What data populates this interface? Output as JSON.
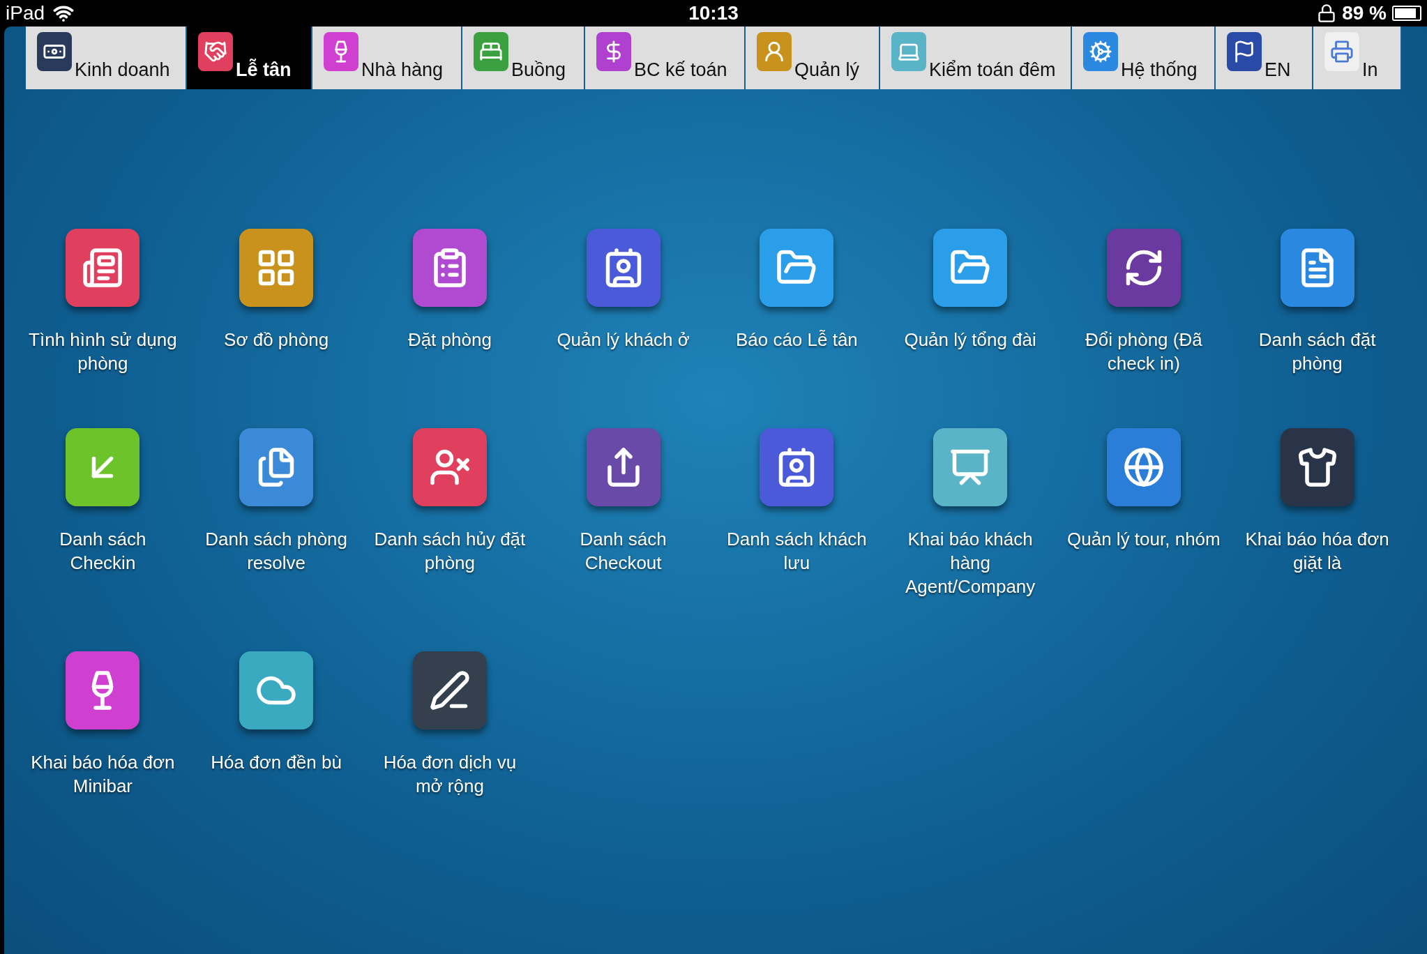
{
  "status_bar": {
    "device": "iPad",
    "time": "10:13",
    "battery": "89 %"
  },
  "tabs": [
    {
      "label": "Kinh doanh",
      "selected": false
    },
    {
      "label": "Lễ tân",
      "selected": true
    },
    {
      "label": "Nhà hàng",
      "selected": false
    },
    {
      "label": "Buồng",
      "selected": false
    },
    {
      "label": "BC kế toán",
      "selected": false
    },
    {
      "label": "Quản lý",
      "selected": false
    },
    {
      "label": "Kiểm toán đêm",
      "selected": false
    },
    {
      "label": "Hệ thống",
      "selected": false
    },
    {
      "label": "EN",
      "selected": false
    },
    {
      "label": "In",
      "selected": false
    }
  ],
  "apps": [
    {
      "label": "Tình hình sử dụng phòng",
      "color": "#e0405e"
    },
    {
      "label": "Sơ đồ phòng",
      "color": "#c8921c"
    },
    {
      "label": "Đặt phòng",
      "color": "#b04ad0"
    },
    {
      "label": "Quản lý khách ở",
      "color": "#4a5ad8"
    },
    {
      "label": "Báo cáo Lễ tân",
      "color": "#2a9ee8"
    },
    {
      "label": "Quản lý tổng đài",
      "color": "#2a9ee8"
    },
    {
      "label": "Đổi phòng (Đã check in)",
      "color": "#6a3aa0"
    },
    {
      "label": "Danh sách đặt phòng",
      "color": "#2a88e0"
    },
    {
      "label": "Danh sách Checkin",
      "color": "#6cc42a"
    },
    {
      "label": "Danh sách phòng resolve",
      "color": "#3a8ad8"
    },
    {
      "label": "Danh sách hủy đặt phòng",
      "color": "#e0405e"
    },
    {
      "label": "Danh sách Checkout",
      "color": "#6a4aa8"
    },
    {
      "label": "Danh sách khách lưu",
      "color": "#4a5ad8"
    },
    {
      "label": "Khai báo khách hàng Agent/Company",
      "color": "#5ab4c8"
    },
    {
      "label": "Quản lý tour, nhóm",
      "color": "#2a7ed8"
    },
    {
      "label": "Khai báo hóa đơn giặt là",
      "color": "#2a3448"
    },
    {
      "label": "Khai báo hóa đơn Minibar",
      "color": "#d040d0"
    },
    {
      "label": "Hóa đơn đền bù",
      "color": "#3aaac0"
    },
    {
      "label": "Hóa đơn dịch vụ mở rộng",
      "color": "#34404e"
    }
  ]
}
